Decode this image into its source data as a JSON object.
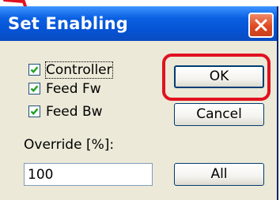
{
  "dialog": {
    "title": "Set Enabling",
    "close_icon": "close-x-icon"
  },
  "checkboxes": [
    {
      "label": "Controller",
      "checked": true,
      "focused": true
    },
    {
      "label": "Feed Fw",
      "checked": true
    },
    {
      "label": "Feed Bw",
      "checked": true
    }
  ],
  "override": {
    "label": "Override [%]:",
    "value": "100"
  },
  "buttons": {
    "ok": "OK",
    "cancel": "Cancel",
    "all": "All"
  },
  "colors": {
    "titlebar": "#0553d4",
    "dialog_bg": "#ece9d8",
    "checkmark": "#21a121",
    "close_button": "#de4a21",
    "annotation": "#e01220"
  }
}
